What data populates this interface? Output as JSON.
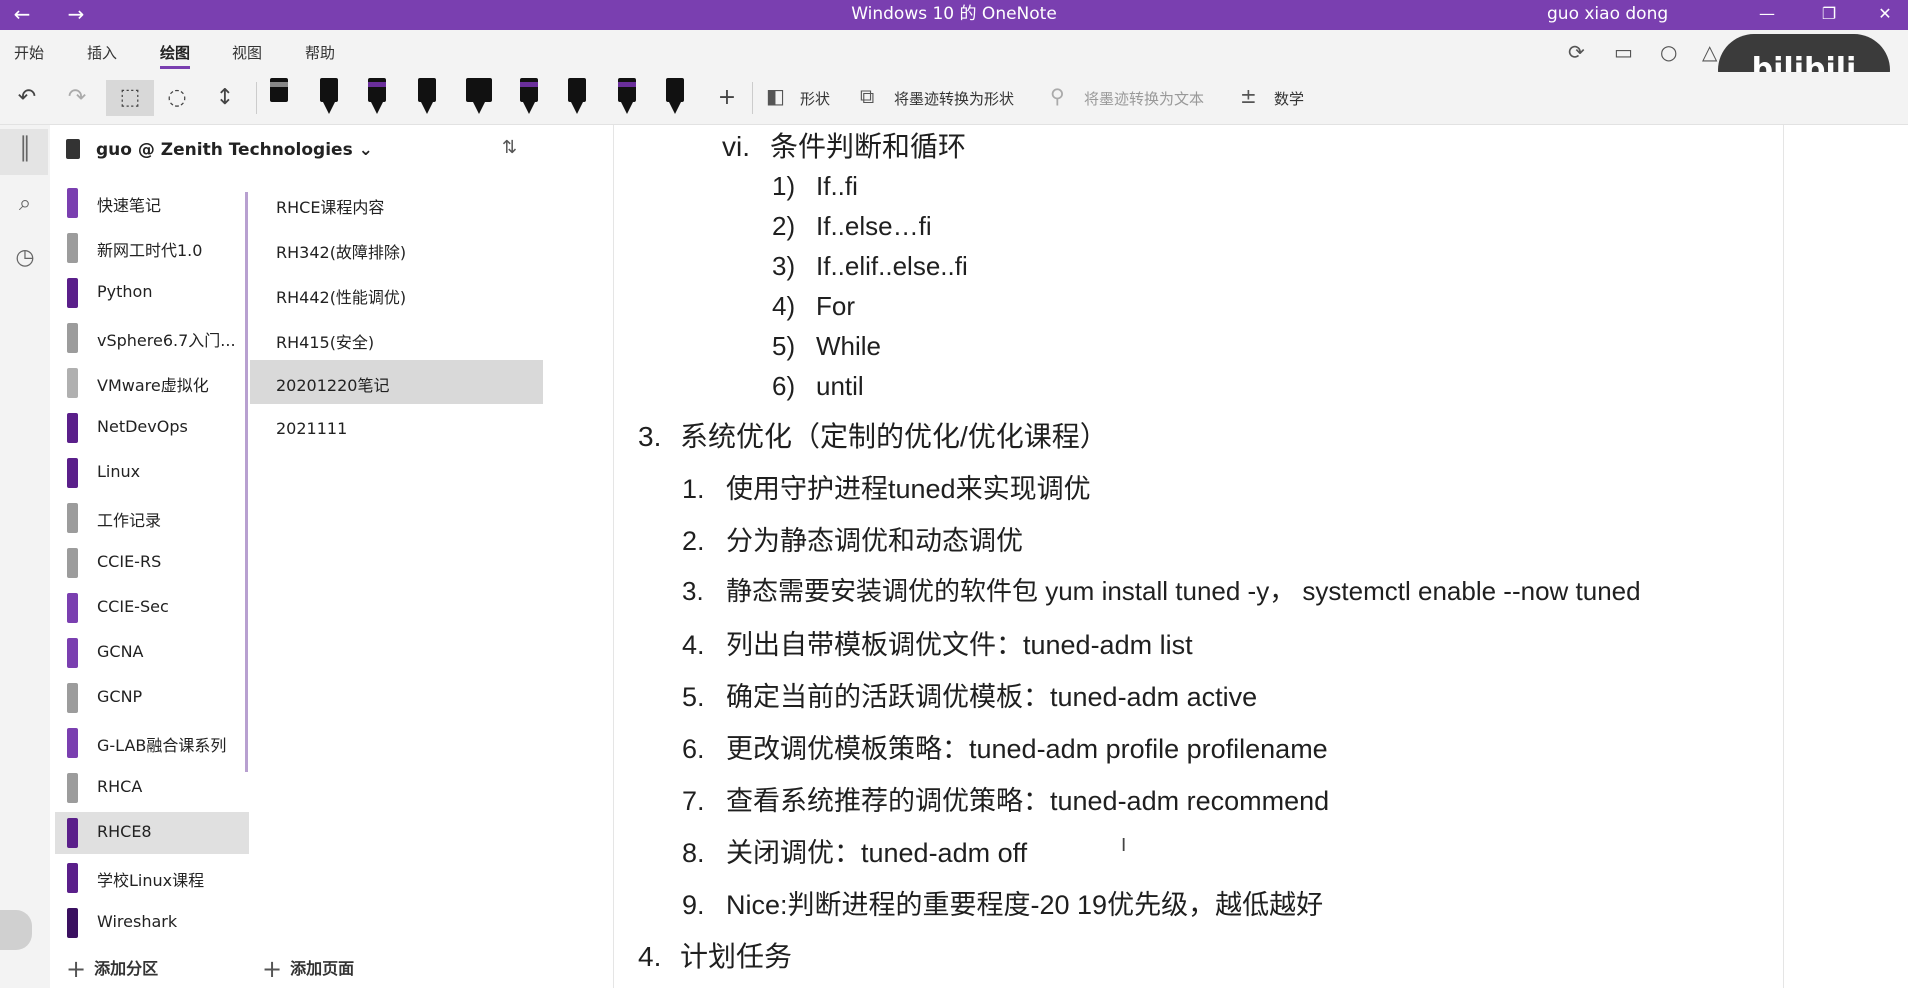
{
  "titlebar": {
    "back": "←",
    "forward": "→",
    "title": "Windows 10 的 OneNote",
    "user": "guo xiao dong",
    "minimize": "—",
    "restore": "❐",
    "close": "✕"
  },
  "menu": {
    "tabs": [
      "开始",
      "插入",
      "绘图",
      "视图",
      "帮助"
    ],
    "active": "绘图"
  },
  "watermark": "bilibili",
  "toolbar": {
    "shape_label": "形状",
    "ink_to_shape_label": "将墨迹转换为形状",
    "ink_to_text_label": "将墨迹转换为文本",
    "math_label": "数学",
    "colors": {
      "accent": "#7a3fb0",
      "pen_dark": "#111111",
      "pen_purple": "#6a2f9a"
    }
  },
  "notebook": {
    "name": "guo @ Zenith Technologies",
    "sections": [
      {
        "label": "快速笔记",
        "color": "#7a3fb0"
      },
      {
        "label": "新网工时代1.0",
        "color": "#9c9c9c"
      },
      {
        "label": "Python",
        "color": "#5a1f8a"
      },
      {
        "label": "vSphere6.7入门...",
        "color": "#9c9c9c"
      },
      {
        "label": "VMware虚拟化",
        "color": "#b0b0b0"
      },
      {
        "label": "NetDevOps",
        "color": "#5a1f8a"
      },
      {
        "label": "Linux",
        "color": "#5a1f8a"
      },
      {
        "label": "工作记录",
        "color": "#9c9c9c"
      },
      {
        "label": "CCIE-RS",
        "color": "#9c9c9c"
      },
      {
        "label": "CCIE-Sec",
        "color": "#7a3fb0"
      },
      {
        "label": "GCNA",
        "color": "#7a3fb0"
      },
      {
        "label": "GCNP",
        "color": "#9c9c9c"
      },
      {
        "label": "G-LAB融合课系列",
        "color": "#7a3fb0"
      },
      {
        "label": "RHCA",
        "color": "#9c9c9c"
      },
      {
        "label": "RHCE8",
        "color": "#5a1f8a"
      },
      {
        "label": "学校Linux课程",
        "color": "#5a1f8a"
      },
      {
        "label": "Wireshark",
        "color": "#3a1060"
      }
    ],
    "selected_section": "RHCE8",
    "pages": [
      "RHCE课程内容",
      "RH342(故障排除)",
      "RH442(性能调优)",
      "RH415(安全)",
      "20201220笔记",
      "2021111"
    ],
    "selected_page": "20201220笔记",
    "add_section": "添加分区",
    "add_page": "添加页面"
  },
  "content": {
    "heading_vi": {
      "num": "vi.",
      "text": "条件判断和循环"
    },
    "loops": [
      {
        "num": "1)",
        "text": "If..fi"
      },
      {
        "num": "2)",
        "text": "If..else…fi"
      },
      {
        "num": "3)",
        "text": "If..elif..else..fi"
      },
      {
        "num": "4)",
        "text": "For"
      },
      {
        "num": "5)",
        "text": "While"
      },
      {
        "num": "6)",
        "text": "until"
      }
    ],
    "section3": {
      "num": "3.",
      "text": "系统优化（定制的优化/优化课程）"
    },
    "tuning": [
      {
        "num": "1.",
        "text": "使用守护进程tuned来实现调优"
      },
      {
        "num": "2.",
        "text": "分为静态调优和动态调优"
      },
      {
        "num": "3.",
        "text": "静态需要安装调优的软件包 yum install tuned -y， systemctl enable --now tuned"
      },
      {
        "num": "4.",
        "text": "列出自带模板调优文件：tuned-adm list"
      },
      {
        "num": "5.",
        "text": "确定当前的活跃调优模板：tuned-adm active"
      },
      {
        "num": "6.",
        "text": "更改调优模板策略：tuned-adm profile profilename"
      },
      {
        "num": "7.",
        "text": "查看系统推荐的调优策略：tuned-adm recommend"
      },
      {
        "num": "8.",
        "text": "关闭调优：tuned-adm off"
      },
      {
        "num": "9.",
        "text": "Nice:判断进程的重要程度-20  19优先级，越低越好"
      }
    ],
    "section4": {
      "num": "4.",
      "text": "计划任务"
    }
  }
}
